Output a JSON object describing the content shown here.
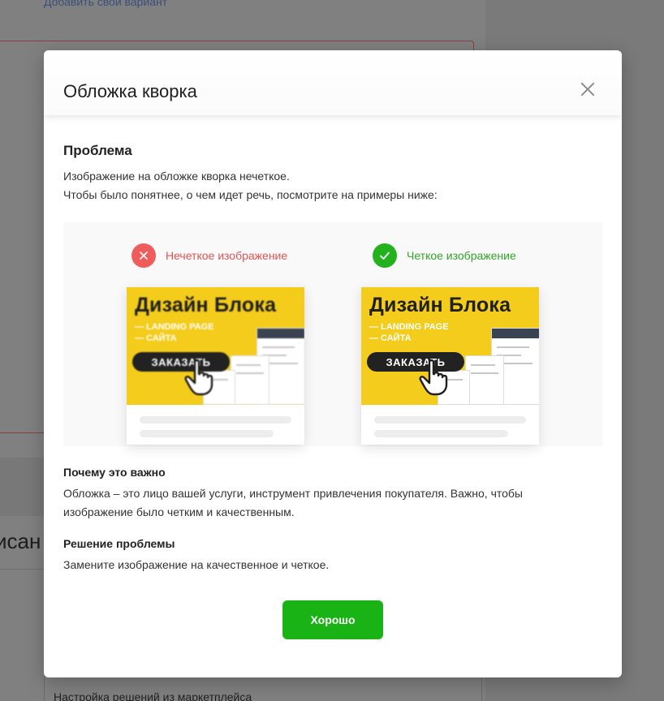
{
  "background": {
    "link_text": "Добавить свой вариант",
    "heading_fragment": "исан",
    "field_text": "Настройка решений из маркетплейса"
  },
  "modal": {
    "title": "Обложка кворка",
    "problem": {
      "title": "Проблема",
      "line1": "Изображение на обложке кворка нечеткое.",
      "line2": "Чтобы было понятнее, о чем идет речь, посмотрите на примеры ниже:"
    },
    "examples": {
      "bad": {
        "label": "Нечеткое изображение",
        "icon": "x-icon",
        "color": "#ee5c5c"
      },
      "good": {
        "label": "Четкое изображение",
        "icon": "check-icon",
        "color": "#23b11e"
      },
      "banner": {
        "title": "Дизайн Блока",
        "line1": "— LANDING PAGE",
        "line2": "— САЙТА",
        "button": "ЗАКАЗАТЬ",
        "background_color": "#f4cc1c"
      }
    },
    "why": {
      "title": "Почему это важно",
      "text": "Обложка – это лицо вашей услуги, инструмент привлечения покупателя. Важно, чтобы изображение было четким и качественным."
    },
    "solution": {
      "title": "Решение проблемы",
      "text": "Замените изображение на качественное и четкое."
    },
    "ok_button": "Хорошо",
    "accent_color": "#19b316"
  }
}
